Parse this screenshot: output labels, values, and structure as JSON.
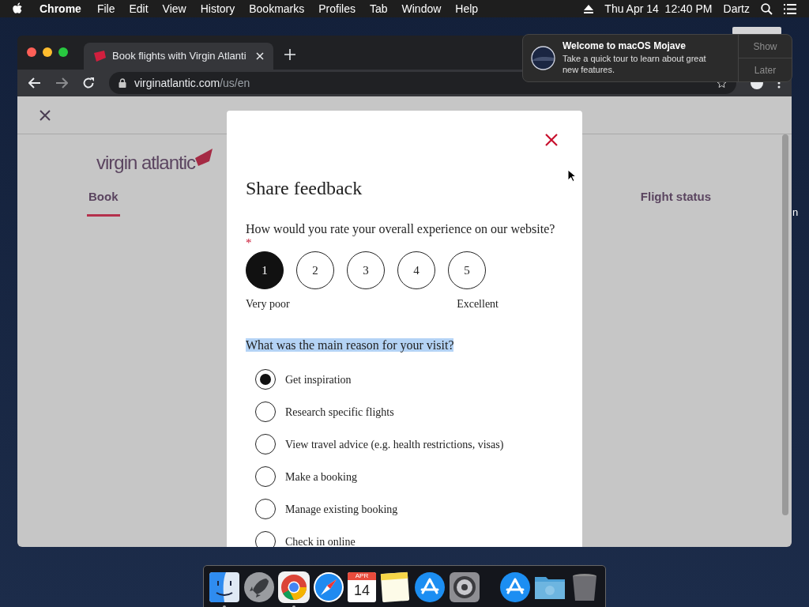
{
  "menu_bar": {
    "app": "Chrome",
    "menus": [
      "File",
      "Edit",
      "View",
      "History",
      "Bookmarks",
      "Profiles",
      "Tab",
      "Window",
      "Help"
    ],
    "clock": "Thu Apr 14  12:40 PM",
    "user": "Dartz"
  },
  "browser": {
    "tab_title": "Book flights with Virgin Atlanti",
    "url_host": "virginatlantic.com",
    "url_path": "/us/en"
  },
  "page": {
    "logo": "virgin atlantic",
    "nav": [
      {
        "label": "Book",
        "selected": true
      },
      {
        "label": "Flight status",
        "selected": false
      }
    ]
  },
  "modal": {
    "title": "Share feedback",
    "question1": "How would you rate your overall experience on our website?",
    "required_mark": "*",
    "rating": [
      {
        "label": "1",
        "selected": true
      },
      {
        "label": "2",
        "selected": false
      },
      {
        "label": "3",
        "selected": false
      },
      {
        "label": "4",
        "selected": false
      },
      {
        "label": "5",
        "selected": false
      }
    ],
    "rating_low": "Very poor",
    "rating_high": "Excellent",
    "question2": "What was the main reason for your visit?",
    "question2_highlighted": true,
    "options": [
      {
        "label": "Get inspiration",
        "selected": true
      },
      {
        "label": "Research specific flights",
        "selected": false
      },
      {
        "label": "View travel advice (e.g. health restrictions, visas)",
        "selected": false
      },
      {
        "label": "Make a booking",
        "selected": false
      },
      {
        "label": "Manage existing booking",
        "selected": false
      },
      {
        "label": "Check in online",
        "selected": false
      }
    ]
  },
  "notification": {
    "title": "Welcome to macOS Mojave",
    "body": "Take a quick tour to learn about great new features.",
    "buttons": [
      "Show",
      "Later"
    ]
  },
  "desktop_label": "n",
  "dock": {
    "items": [
      {
        "kind": "finder",
        "running": true
      },
      {
        "kind": "launchpad",
        "running": false
      },
      {
        "kind": "chrome",
        "running": true
      },
      {
        "kind": "safari",
        "running": false
      },
      {
        "kind": "calendar",
        "month": "APR",
        "day": "14",
        "running": false
      },
      {
        "kind": "notes",
        "running": false
      },
      {
        "kind": "appstore",
        "running": false
      },
      {
        "kind": "settings",
        "running": false
      },
      {
        "kind": "divider"
      },
      {
        "kind": "appstore",
        "running": false
      },
      {
        "kind": "folder",
        "running": false
      },
      {
        "kind": "trash",
        "running": false
      }
    ]
  }
}
